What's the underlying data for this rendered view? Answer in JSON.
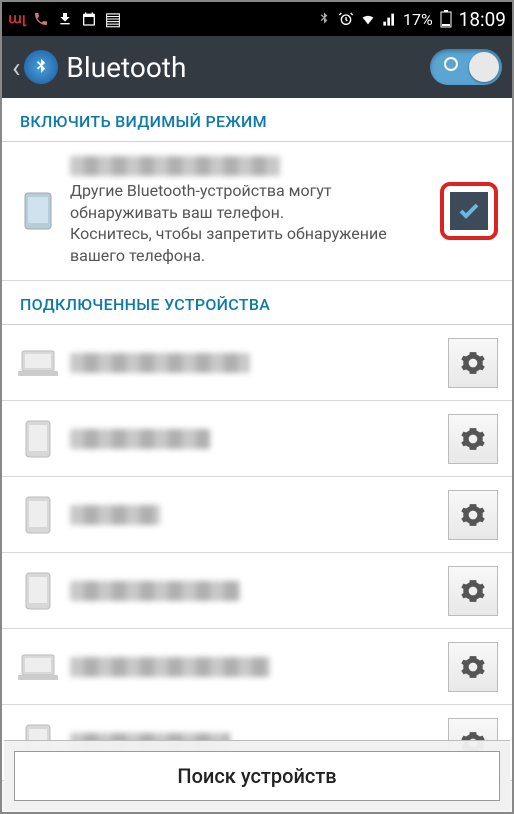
{
  "status": {
    "battery_pct": "17%",
    "time": "18:09"
  },
  "header": {
    "title": "Bluetooth"
  },
  "sections": {
    "visibility_header": "ВКЛЮЧИТЬ ВИДИМЫЙ РЕЖИМ",
    "paired_header": "ПОДКЛЮЧЕННЫЕ УСТРОЙСТВА"
  },
  "visibility": {
    "description": "Другие Bluetooth-устройства могут обнаруживать ваш телефон.\nКоснитесь, чтобы запретить обнаружение вашего телефона.",
    "checked": true
  },
  "devices": [
    {
      "type": "laptop"
    },
    {
      "type": "phone"
    },
    {
      "type": "phone"
    },
    {
      "type": "phone"
    },
    {
      "type": "laptop"
    },
    {
      "type": "phone"
    }
  ],
  "footer": {
    "search_label": "Поиск устройств"
  },
  "colors": {
    "accent": "#0d7aa8",
    "highlight": "#d22"
  }
}
